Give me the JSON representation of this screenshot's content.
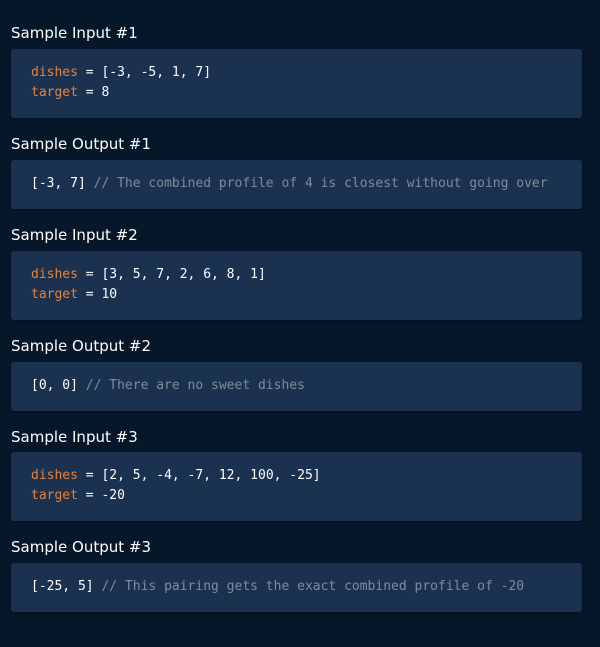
{
  "sections": [
    {
      "title": "Sample Input #1",
      "lines": [
        {
          "name": "dishes",
          "op": " = ",
          "value": "[-3, -5, 1, 7]"
        },
        {
          "name": "target",
          "op": " = ",
          "value": "8"
        }
      ]
    },
    {
      "title": "Sample Output #1",
      "output": {
        "value": "[-3, 7]",
        "comment": " // The combined profile of 4 is closest without going over"
      }
    },
    {
      "title": "Sample Input #2",
      "lines": [
        {
          "name": "dishes",
          "op": " = ",
          "value": "[3, 5, 7, 2, 6, 8, 1]"
        },
        {
          "name": "target",
          "op": " = ",
          "value": "10"
        }
      ]
    },
    {
      "title": "Sample Output #2",
      "output": {
        "value": "[0, 0]",
        "comment": " // There are no sweet dishes"
      }
    },
    {
      "title": "Sample Input #3",
      "lines": [
        {
          "name": "dishes",
          "op": " = ",
          "value": "[2, 5, -4, -7, 12, 100, -25]"
        },
        {
          "name": "target",
          "op": " = ",
          "value": "-20"
        }
      ]
    },
    {
      "title": "Sample Output #3",
      "output": {
        "value": "[-25, 5]",
        "comment": " // This pairing gets the exact combined profile of -20"
      }
    }
  ],
  "colors": {
    "background": "#06172a",
    "code_box": "#1a324f",
    "variable": "#e8813a",
    "comment": "#7f8c99"
  }
}
